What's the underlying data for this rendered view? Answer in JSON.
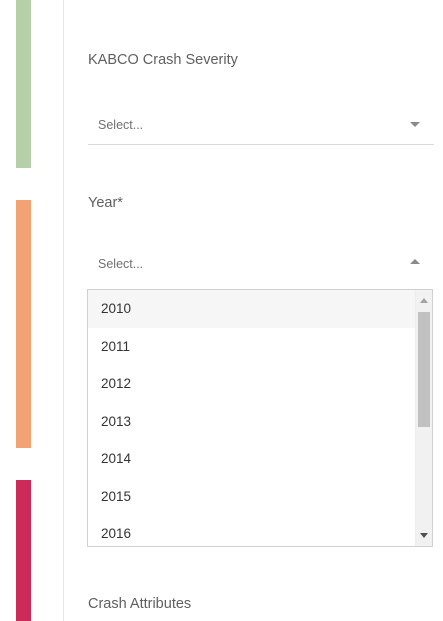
{
  "colors": {
    "accent_green": "#b7cfa8",
    "accent_orange": "#f2a273",
    "accent_pink": "#cc2b5a"
  },
  "kabco": {
    "label": "KABCO Crash Severity",
    "placeholder": "Select..."
  },
  "year": {
    "label": "Year*",
    "placeholder": "Select...",
    "options": [
      "2010",
      "2011",
      "2012",
      "2013",
      "2014",
      "2015",
      "2016"
    ]
  },
  "attributes": {
    "label": "Crash Attributes"
  }
}
